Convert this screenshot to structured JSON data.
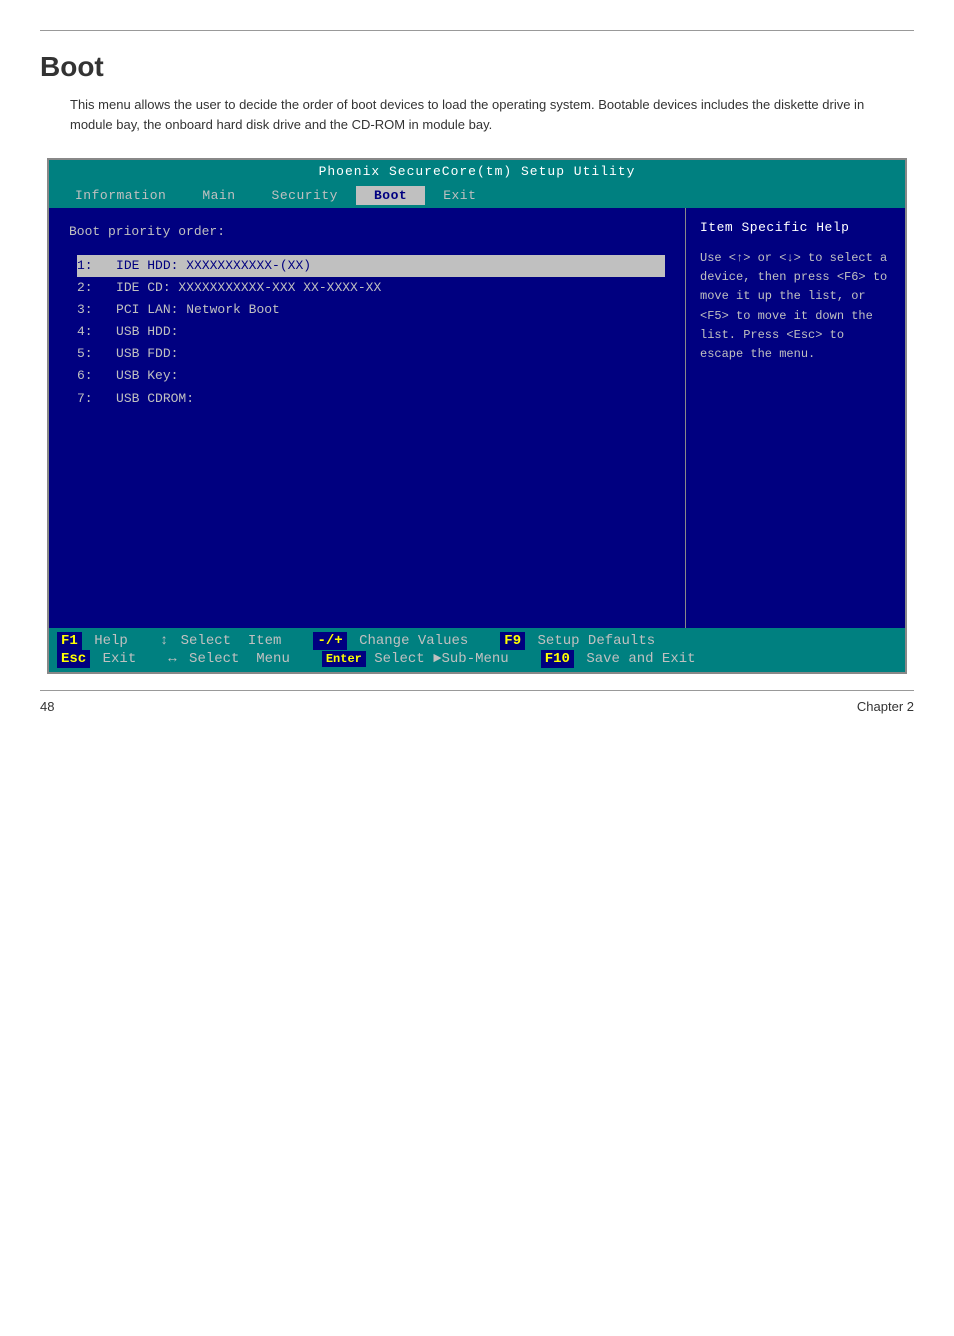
{
  "page": {
    "top_border": true,
    "title": "Boot",
    "description": "This menu allows the user to decide the order of boot devices to load the operating system. Bootable devices includes the diskette drive in module bay, the onboard hard disk drive and the CD-ROM in module bay.",
    "footer": {
      "page_number": "48",
      "chapter": "Chapter 2"
    }
  },
  "bios": {
    "title": "Phoenix SecureCore(tm) Setup Utility",
    "menu_items": [
      {
        "label": "Information",
        "active": false
      },
      {
        "label": "Main",
        "active": false
      },
      {
        "label": "Security",
        "active": false
      },
      {
        "label": "Boot",
        "active": true
      },
      {
        "label": "Exit",
        "active": false
      }
    ],
    "main_panel": {
      "boot_priority_label": "Boot priority order:",
      "boot_items": [
        {
          "number": "1:",
          "name": "IDE HDD: XXXXXXXXXXX-(XX)",
          "selected": true
        },
        {
          "number": "2:",
          "name": "IDE CD: XXXXXXXXXXX-XXX XX-XXXX-XX",
          "selected": false
        },
        {
          "number": "3:",
          "name": "PCI LAN: Network Boot",
          "selected": false
        },
        {
          "number": "4:",
          "name": "USB HDD:",
          "selected": false
        },
        {
          "number": "5:",
          "name": "USB FDD:",
          "selected": false
        },
        {
          "number": "6:",
          "name": "USB Key:",
          "selected": false
        },
        {
          "number": "7:",
          "name": "USB CDROM:",
          "selected": false
        }
      ]
    },
    "help_panel": {
      "title": "Item Specific Help",
      "text": "Use <↑> or <↓> to select a device, then press <F6> to move it up the list, or <F5> to move it down the list. Press <Esc> to escape the menu."
    },
    "status_bar": {
      "rows": [
        [
          {
            "key": "F1",
            "label": "Help"
          },
          {
            "arrow": "↕",
            "key2": "Select",
            "label2": "Item"
          },
          {
            "key": "-/+",
            "label": "Change Values"
          },
          {
            "key": "F9",
            "label": "Setup Defaults"
          }
        ],
        [
          {
            "key": "Esc",
            "label": "Exit"
          },
          {
            "arrow": "↔",
            "key2": "Select",
            "label2": "Menu"
          },
          {
            "key": "Enter",
            "label": "Select ►Sub-Menu"
          },
          {
            "key": "F10",
            "label": "Save and Exit"
          }
        ]
      ]
    }
  }
}
